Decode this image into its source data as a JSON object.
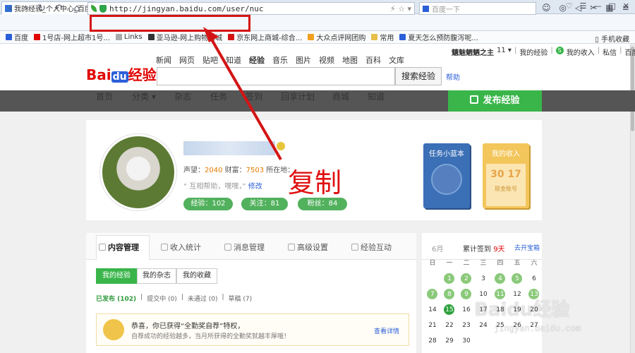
{
  "browser": {
    "tab_title": "我的经验_个人中心_百度...",
    "tab_close": "×",
    "new_tab": "+",
    "url": "http://jingyan.baidu.com/user/nuc",
    "search_placeholder": "百度一下",
    "win_controls": [
      "♡",
      "☰",
      "—",
      "□",
      "✕"
    ],
    "bookmarks": [
      {
        "label": "百度",
        "color": "#2b5fd9"
      },
      {
        "label": "1号店-网上超市1号...",
        "color": "#e10602"
      },
      {
        "label": "Links",
        "color": "#aaaaaa"
      },
      {
        "label": "亚马逊-网上购物商城",
        "color": "#333333"
      },
      {
        "label": "京东网上商城-综合...",
        "color": "#d41414"
      },
      {
        "label": "大众点评网团购",
        "color": "#f0a020"
      },
      {
        "label": "常用",
        "color": "#e6c04a"
      },
      {
        "label": "夏天怎么预防腹泻呢...",
        "color": "#2b5fd9"
      }
    ],
    "mobile_fav": "手机收藏"
  },
  "site": {
    "logo": {
      "bai": "Bai",
      "du": "du",
      "jy": "经验"
    },
    "topnav": [
      "新闻",
      "网页",
      "贴吧",
      "知道",
      "经验",
      "音乐",
      "图片",
      "视频",
      "地图",
      "百科",
      "文库"
    ],
    "topnav_active": "经验",
    "search_button": "搜索经验",
    "help": "帮助",
    "userbar": {
      "name": "魑魅魍魉之主",
      "level": "11 ▾",
      "my_exp": "我的经验",
      "my_income": "我的收入",
      "message": "私信",
      "home": "百度首页",
      "s_badge": "S",
      "sep": "|"
    }
  },
  "mainnav": {
    "items": [
      "首页",
      "分类 ▾",
      "杂志",
      "任务",
      "签到",
      "回享计划",
      "商城",
      "知道"
    ],
    "active": "杂志",
    "publish": "发布经验"
  },
  "profile": {
    "stats_prefix": "声望：",
    "stats_value": "2040",
    "stats_mid": " 财富：",
    "stats_value2": "7503",
    "stats_tail": " 所在地：",
    "motto": "“ 互相帮助，嘿嘿，”",
    "edit": "修改",
    "pills": [
      {
        "label": "经验：102"
      },
      {
        "label": "关注：81"
      },
      {
        "label": "粉丝：84"
      }
    ],
    "book1_title": "任务小蓝本",
    "book2_title": "我的收入",
    "book2_value": "30 17",
    "book2_foot": "现金账号"
  },
  "annotation": "复制",
  "content": {
    "tabs": [
      "内容管理",
      "收入统计",
      "消息管理",
      "高级设置",
      "经验互动"
    ],
    "subtabs": [
      "我的经验",
      "我的杂志",
      "我的收藏"
    ],
    "filters": [
      {
        "label": "已发布 (102)"
      },
      {
        "label": "|"
      },
      {
        "label": "提交中 (0)"
      },
      {
        "label": "|"
      },
      {
        "label": "未通过 (0)"
      },
      {
        "label": "|"
      },
      {
        "label": "草稿 (7)"
      }
    ],
    "notice_title": "恭喜，你已获得“全勤奖自荐”特权，",
    "notice_body": "自荐成功的经验越多，当月所获得的全勤奖就越丰厚哦！",
    "notice_link": "查看详情"
  },
  "calendar": {
    "month": "6月",
    "sign_label": "累计签到",
    "sign_days": "9天",
    "link": "去开宝箱",
    "weekdays": [
      "日",
      "一",
      "二",
      "三",
      "四",
      "五",
      "六"
    ],
    "rows": [
      [
        "",
        "1",
        "2",
        "3",
        "4",
        "5",
        "6"
      ],
      [
        "7",
        "8",
        "9",
        "10",
        "11",
        "12",
        "13"
      ],
      [
        "14",
        "15",
        "16",
        "17",
        "18",
        "19",
        "20"
      ],
      [
        "21",
        "22",
        "23",
        "24",
        "25",
        "26",
        "27"
      ],
      [
        "28",
        "29",
        "30",
        "",
        "",
        "",
        ""
      ]
    ],
    "signed": [
      "1",
      "2",
      "4",
      "5",
      "7",
      "8",
      "9",
      "11",
      "13"
    ],
    "today": "15"
  },
  "watermark": {
    "text": "Baidu经验",
    "url": "jingyan.baidu.com"
  }
}
